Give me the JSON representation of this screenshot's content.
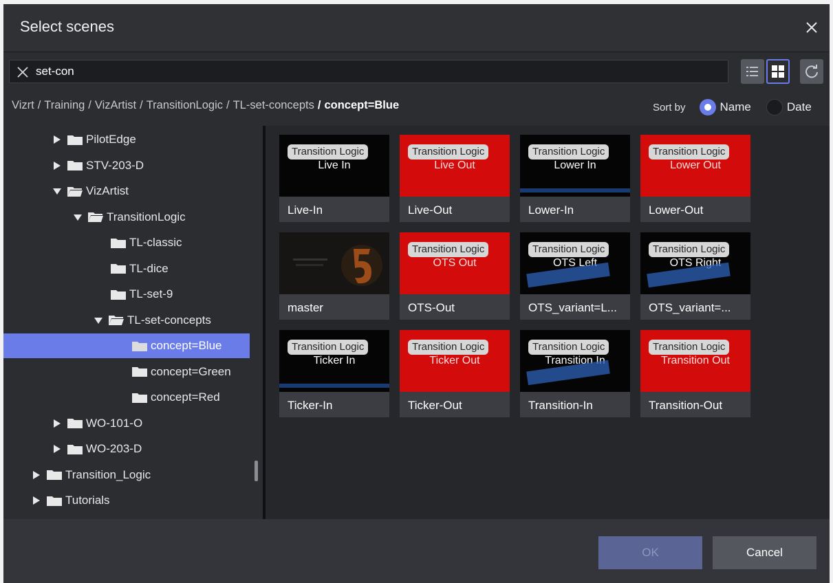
{
  "dialog": {
    "title": "Select scenes"
  },
  "search": {
    "value": "set-con"
  },
  "breadcrumb": {
    "parts": [
      "Vizrt",
      "Training",
      "VizArtist",
      "TransitionLogic",
      "TL-set-concepts"
    ],
    "current": "concept=Blue",
    "separator": "/"
  },
  "sort": {
    "label": "Sort by",
    "options": [
      "Name",
      "Date"
    ],
    "selected": "Name"
  },
  "tree": {
    "items": [
      {
        "label": "PilotEdge",
        "state": "collapsed"
      },
      {
        "label": "STV-203-D",
        "state": "collapsed"
      },
      {
        "label": "VizArtist",
        "state": "expanded"
      },
      {
        "label": "TransitionLogic",
        "state": "expanded"
      },
      {
        "label": "TL-classic",
        "state": "leaf"
      },
      {
        "label": "TL-dice",
        "state": "leaf"
      },
      {
        "label": "TL-set-9",
        "state": "leaf"
      },
      {
        "label": "TL-set-concepts",
        "state": "expanded"
      },
      {
        "label": "concept=Blue",
        "state": "leaf",
        "selected": true
      },
      {
        "label": "concept=Green",
        "state": "leaf"
      },
      {
        "label": "concept=Red",
        "state": "leaf"
      },
      {
        "label": "WO-101-O",
        "state": "collapsed"
      },
      {
        "label": "WO-203-D",
        "state": "collapsed"
      },
      {
        "label": "Transition_Logic",
        "state": "collapsed"
      },
      {
        "label": "Tutorials",
        "state": "collapsed"
      }
    ]
  },
  "scenes": [
    {
      "label": "Live-In",
      "tag": "Transition Logic",
      "subtitle": "Live In"
    },
    {
      "label": "Live-Out",
      "tag": "Transition Logic",
      "subtitle": "Live Out"
    },
    {
      "label": "Lower-In",
      "tag": "Transition Logic",
      "subtitle": "Lower In"
    },
    {
      "label": "Lower-Out",
      "tag": "Transition Logic",
      "subtitle": "Lower Out"
    },
    {
      "label": "master",
      "tag": "",
      "subtitle": ""
    },
    {
      "label": "OTS-Out",
      "tag": "Transition Logic",
      "subtitle": "OTS Out"
    },
    {
      "label": "OTS_variant=L...",
      "tag": "Transition Logic",
      "subtitle": "OTS Left"
    },
    {
      "label": "OTS_variant=...",
      "tag": "Transition Logic",
      "subtitle": "OTS Right"
    },
    {
      "label": "Ticker-In",
      "tag": "Transition Logic",
      "subtitle": "Ticker In"
    },
    {
      "label": "Ticker-Out",
      "tag": "Transition Logic",
      "subtitle": "Ticker Out"
    },
    {
      "label": "Transition-In",
      "tag": "Transition Logic",
      "subtitle": "Transition In"
    },
    {
      "label": "Transition-Out",
      "tag": "Transition Logic",
      "subtitle": "Transition Out"
    }
  ],
  "footer": {
    "ok_label": "OK",
    "cancel_label": "Cancel"
  },
  "colors": {
    "accent": "#6a7ce8",
    "red_thumb": "#d40b0b",
    "background": "#2b2d31"
  }
}
